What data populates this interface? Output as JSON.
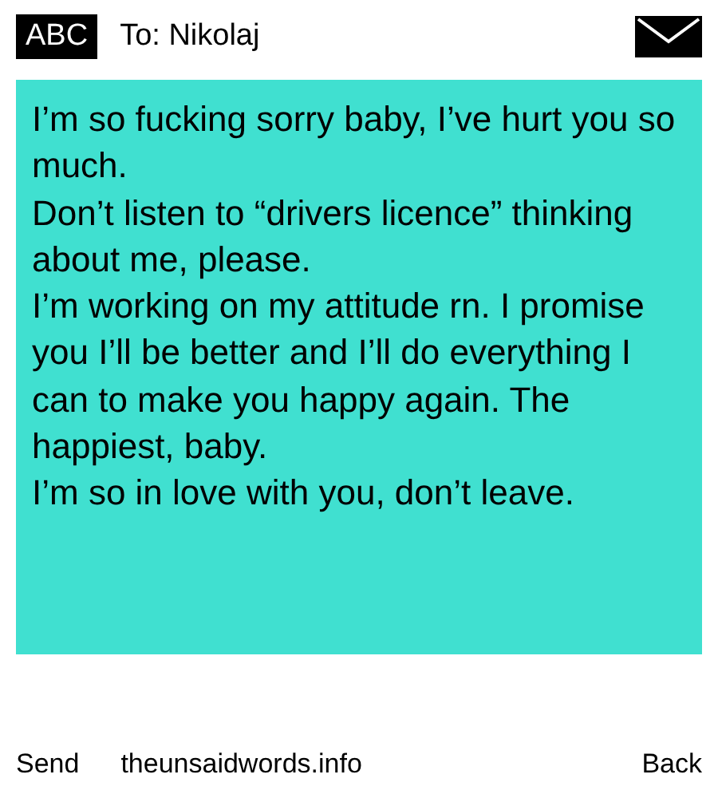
{
  "header": {
    "mode_label": "ABC",
    "recipient": "To: Nikolaj"
  },
  "message": {
    "paragraphs": [
      "I’m so fucking sorry baby, I’ve hurt you so much.",
      "Don’t listen to “drivers licence” thinking about me, please.",
      "I’m working on my attitude rn. I promise you I’ll be better and I’ll do everything I can to make you happy again. The happiest, baby.",
      "I’m so in love with you, don’t leave."
    ]
  },
  "footer": {
    "send": "Send",
    "site": "theunsaidwords.info",
    "back": "Back"
  }
}
